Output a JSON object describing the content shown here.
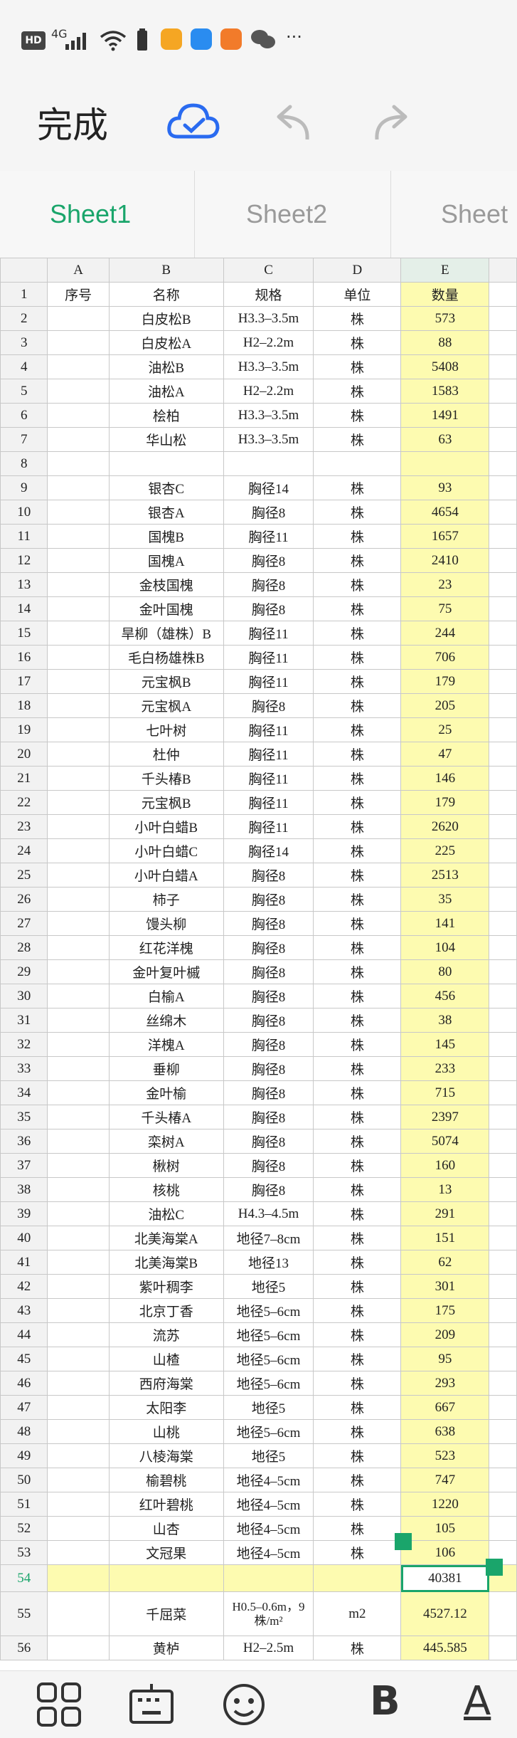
{
  "status_bar": {
    "hd": "HD",
    "signal": "4G",
    "more": "···"
  },
  "toolbar": {
    "done_label": "完成"
  },
  "tabs": [
    "Sheet1",
    "Sheet2",
    "Sheet"
  ],
  "columns": [
    "A",
    "B",
    "C",
    "D",
    "E"
  ],
  "rows": [
    {
      "n": "1",
      "a": "序号",
      "b": "名称",
      "c": "规格",
      "d": "单位",
      "e": "数量"
    },
    {
      "n": "2",
      "a": "",
      "b": "白皮松B",
      "c": "H3.3–3.5m",
      "d": "株",
      "e": "573"
    },
    {
      "n": "3",
      "a": "",
      "b": "白皮松A",
      "c": "H2–2.2m",
      "d": "株",
      "e": "88"
    },
    {
      "n": "4",
      "a": "",
      "b": "油松B",
      "c": "H3.3–3.5m",
      "d": "株",
      "e": "5408"
    },
    {
      "n": "5",
      "a": "",
      "b": "油松A",
      "c": "H2–2.2m",
      "d": "株",
      "e": "1583"
    },
    {
      "n": "6",
      "a": "",
      "b": "桧柏",
      "c": "H3.3–3.5m",
      "d": "株",
      "e": "1491"
    },
    {
      "n": "7",
      "a": "",
      "b": "华山松",
      "c": "H3.3–3.5m",
      "d": "株",
      "e": "63"
    },
    {
      "n": "8",
      "a": "",
      "b": "",
      "c": "",
      "d": "",
      "e": ""
    },
    {
      "n": "9",
      "a": "",
      "b": "银杏C",
      "c": "胸径14",
      "d": "株",
      "e": "93"
    },
    {
      "n": "10",
      "a": "",
      "b": "银杏A",
      "c": "胸径8",
      "d": "株",
      "e": "4654"
    },
    {
      "n": "11",
      "a": "",
      "b": "国槐B",
      "c": "胸径11",
      "d": "株",
      "e": "1657"
    },
    {
      "n": "12",
      "a": "",
      "b": "国槐A",
      "c": "胸径8",
      "d": "株",
      "e": "2410"
    },
    {
      "n": "13",
      "a": "",
      "b": "金枝国槐",
      "c": "胸径8",
      "d": "株",
      "e": "23"
    },
    {
      "n": "14",
      "a": "",
      "b": "金叶国槐",
      "c": "胸径8",
      "d": "株",
      "e": "75"
    },
    {
      "n": "15",
      "a": "",
      "b": "旱柳（雄株）B",
      "c": "胸径11",
      "d": "株",
      "e": "244"
    },
    {
      "n": "16",
      "a": "",
      "b": "毛白杨雄株B",
      "c": "胸径11",
      "d": "株",
      "e": "706"
    },
    {
      "n": "17",
      "a": "",
      "b": "元宝枫B",
      "c": "胸径11",
      "d": "株",
      "e": "179"
    },
    {
      "n": "18",
      "a": "",
      "b": "元宝枫A",
      "c": "胸径8",
      "d": "株",
      "e": "205"
    },
    {
      "n": "19",
      "a": "",
      "b": "七叶树",
      "c": "胸径11",
      "d": "株",
      "e": "25"
    },
    {
      "n": "20",
      "a": "",
      "b": "杜仲",
      "c": "胸径11",
      "d": "株",
      "e": "47"
    },
    {
      "n": "21",
      "a": "",
      "b": "千头椿B",
      "c": "胸径11",
      "d": "株",
      "e": "146"
    },
    {
      "n": "22",
      "a": "",
      "b": "元宝枫B",
      "c": "胸径11",
      "d": "株",
      "e": "179"
    },
    {
      "n": "23",
      "a": "",
      "b": "小叶白蜡B",
      "c": "胸径11",
      "d": "株",
      "e": "2620"
    },
    {
      "n": "24",
      "a": "",
      "b": "小叶白蜡C",
      "c": "胸径14",
      "d": "株",
      "e": "225"
    },
    {
      "n": "25",
      "a": "",
      "b": "小叶白蜡A",
      "c": "胸径8",
      "d": "株",
      "e": "2513"
    },
    {
      "n": "26",
      "a": "",
      "b": "柿子",
      "c": "胸径8",
      "d": "株",
      "e": "35"
    },
    {
      "n": "27",
      "a": "",
      "b": "馒头柳",
      "c": "胸径8",
      "d": "株",
      "e": "141"
    },
    {
      "n": "28",
      "a": "",
      "b": "红花洋槐",
      "c": "胸径8",
      "d": "株",
      "e": "104"
    },
    {
      "n": "29",
      "a": "",
      "b": "金叶复叶槭",
      "c": "胸径8",
      "d": "株",
      "e": "80"
    },
    {
      "n": "30",
      "a": "",
      "b": "白榆A",
      "c": "胸径8",
      "d": "株",
      "e": "456"
    },
    {
      "n": "31",
      "a": "",
      "b": "丝绵木",
      "c": "胸径8",
      "d": "株",
      "e": "38"
    },
    {
      "n": "32",
      "a": "",
      "b": "洋槐A",
      "c": "胸径8",
      "d": "株",
      "e": "145"
    },
    {
      "n": "33",
      "a": "",
      "b": "垂柳",
      "c": "胸径8",
      "d": "株",
      "e": "233"
    },
    {
      "n": "34",
      "a": "",
      "b": "金叶榆",
      "c": "胸径8",
      "d": "株",
      "e": "715"
    },
    {
      "n": "35",
      "a": "",
      "b": "千头椿A",
      "c": "胸径8",
      "d": "株",
      "e": "2397"
    },
    {
      "n": "36",
      "a": "",
      "b": "栾树A",
      "c": "胸径8",
      "d": "株",
      "e": "5074"
    },
    {
      "n": "37",
      "a": "",
      "b": "楸树",
      "c": "胸径8",
      "d": "株",
      "e": "160"
    },
    {
      "n": "38",
      "a": "",
      "b": "核桃",
      "c": "胸径8",
      "d": "株",
      "e": "13"
    },
    {
      "n": "39",
      "a": "",
      "b": "油松C",
      "c": "H4.3–4.5m",
      "d": "株",
      "e": "291"
    },
    {
      "n": "40",
      "a": "",
      "b": "北美海棠A",
      "c": "地径7–8cm",
      "d": "株",
      "e": "151"
    },
    {
      "n": "41",
      "a": "",
      "b": "北美海棠B",
      "c": "地径13",
      "d": "株",
      "e": "62"
    },
    {
      "n": "42",
      "a": "",
      "b": "紫叶稠李",
      "c": "地径5",
      "d": "株",
      "e": "301"
    },
    {
      "n": "43",
      "a": "",
      "b": "北京丁香",
      "c": "地径5–6cm",
      "d": "株",
      "e": "175"
    },
    {
      "n": "44",
      "a": "",
      "b": "流苏",
      "c": "地径5–6cm",
      "d": "株",
      "e": "209"
    },
    {
      "n": "45",
      "a": "",
      "b": "山楂",
      "c": "地径5–6cm",
      "d": "株",
      "e": "95"
    },
    {
      "n": "46",
      "a": "",
      "b": "西府海棠",
      "c": "地径5–6cm",
      "d": "株",
      "e": "293"
    },
    {
      "n": "47",
      "a": "",
      "b": "太阳李",
      "c": "地径5",
      "d": "株",
      "e": "667"
    },
    {
      "n": "48",
      "a": "",
      "b": "山桃",
      "c": "地径5–6cm",
      "d": "株",
      "e": "638"
    },
    {
      "n": "49",
      "a": "",
      "b": "八棱海棠",
      "c": "地径5",
      "d": "株",
      "e": "523"
    },
    {
      "n": "50",
      "a": "",
      "b": "榆碧桃",
      "c": "地径4–5cm",
      "d": "株",
      "e": "747"
    },
    {
      "n": "51",
      "a": "",
      "b": "红叶碧桃",
      "c": "地径4–5cm",
      "d": "株",
      "e": "1220"
    },
    {
      "n": "52",
      "a": "",
      "b": "山杏",
      "c": "地径4–5cm",
      "d": "株",
      "e": "105"
    },
    {
      "n": "53",
      "a": "",
      "b": "文冠果",
      "c": "地径4–5cm",
      "d": "株",
      "e": "106"
    },
    {
      "n": "54",
      "a": "",
      "b": "",
      "c": "",
      "d": "",
      "e": "40381"
    },
    {
      "n": "55",
      "a": "",
      "b": "千屈菜",
      "c": "H0.5–0.6m，9株/m²",
      "d": "m2",
      "e": "4527.12"
    },
    {
      "n": "56",
      "a": "",
      "b": "黄栌",
      "c": "H2–2.5m",
      "d": "株",
      "e": "445.585"
    }
  ],
  "bottom_bar": {
    "bold": "B",
    "font_color": "A"
  },
  "colors": {
    "accent": "#1aa56b",
    "highlight": "#fdfbb0"
  }
}
